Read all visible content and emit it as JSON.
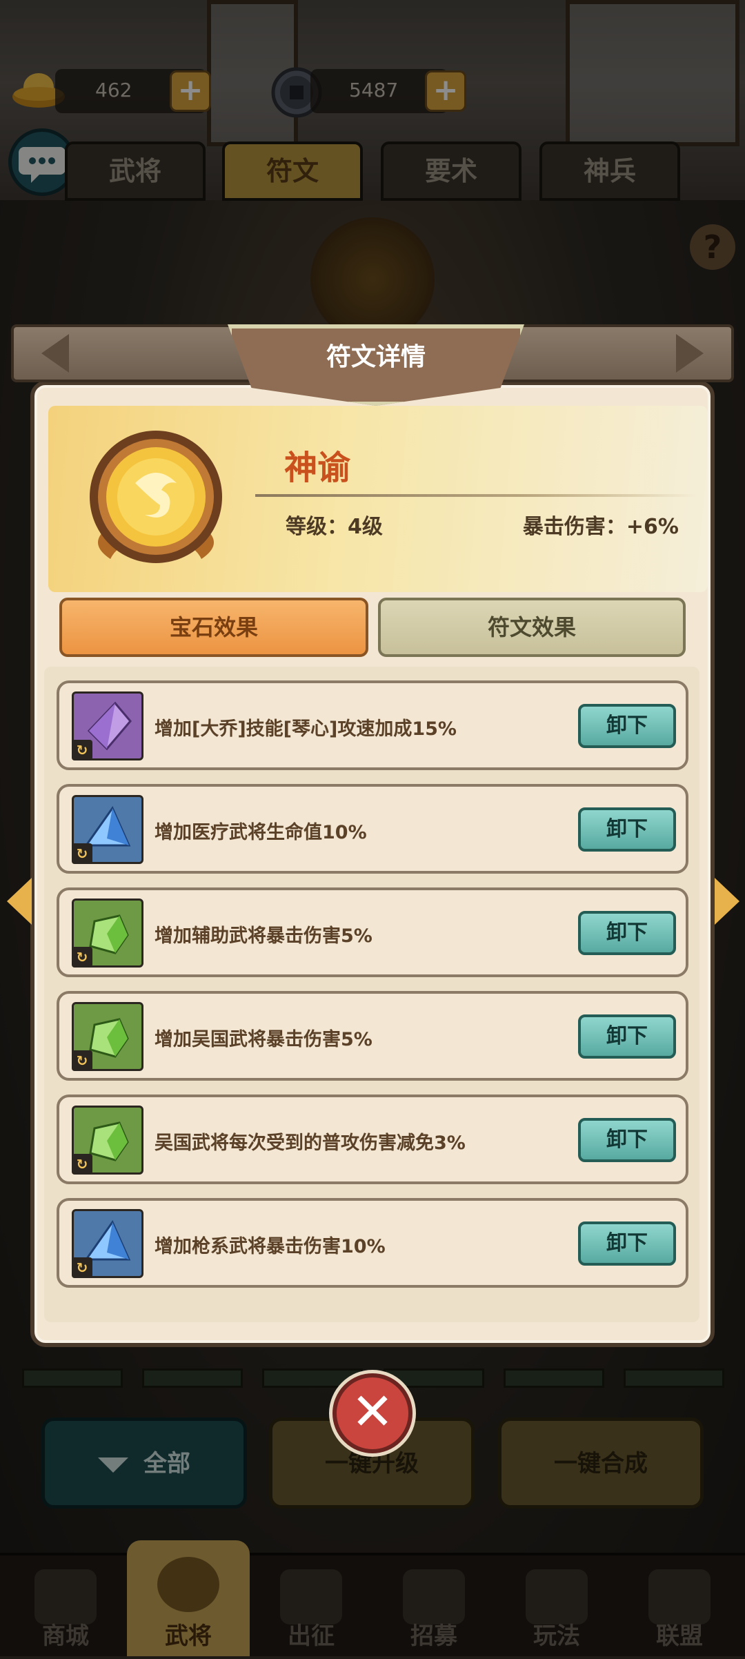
{
  "currency": [
    {
      "icon": "gold-ingot-icon",
      "value": "462"
    },
    {
      "icon": "copper-coin-icon",
      "value": "5487"
    }
  ],
  "top_tabs": [
    {
      "label": "武将",
      "active": false
    },
    {
      "label": "符文",
      "active": true
    },
    {
      "label": "要术",
      "active": false
    },
    {
      "label": "神兵",
      "active": false
    }
  ],
  "modal": {
    "title": "符文详情",
    "rune": {
      "name": "神谕",
      "level_text": "等级：4级",
      "crit_text": "暴击伤害：+6%"
    },
    "tabs": {
      "gem_effect": "宝石效果",
      "rune_effect": "符文效果"
    },
    "gem_rows": [
      {
        "gem": "purple",
        "text": "增加[大乔]技能[琴心]攻速加成15%",
        "button": "卸下"
      },
      {
        "gem": "blue",
        "text": "增加医疗武将生命值10%",
        "button": "卸下"
      },
      {
        "gem": "green",
        "text": "增加辅助武将暴击伤害5%",
        "button": "卸下"
      },
      {
        "gem": "green",
        "text": "增加吴国武将暴击伤害5%",
        "button": "卸下"
      },
      {
        "gem": "green",
        "text": "吴国武将每次受到的普攻伤害减免3%",
        "button": "卸下"
      },
      {
        "gem": "blue",
        "text": "增加枪系武将暴击伤害10%",
        "button": "卸下"
      }
    ]
  },
  "bottom_buttons": {
    "all": "全部",
    "upgrade": "一键升级",
    "merge": "一键合成"
  },
  "navbar": [
    {
      "label": "商城",
      "active": false
    },
    {
      "label": "武将",
      "active": true
    },
    {
      "label": "出征",
      "active": false
    },
    {
      "label": "招募",
      "active": false
    },
    {
      "label": "玩法",
      "active": false
    },
    {
      "label": "联盟",
      "active": false
    }
  ],
  "colors": {
    "accent_orange": "#ec9442",
    "rune_name": "#c8511e",
    "unload_teal": "#58aaa1",
    "close_red": "#c9453e"
  }
}
